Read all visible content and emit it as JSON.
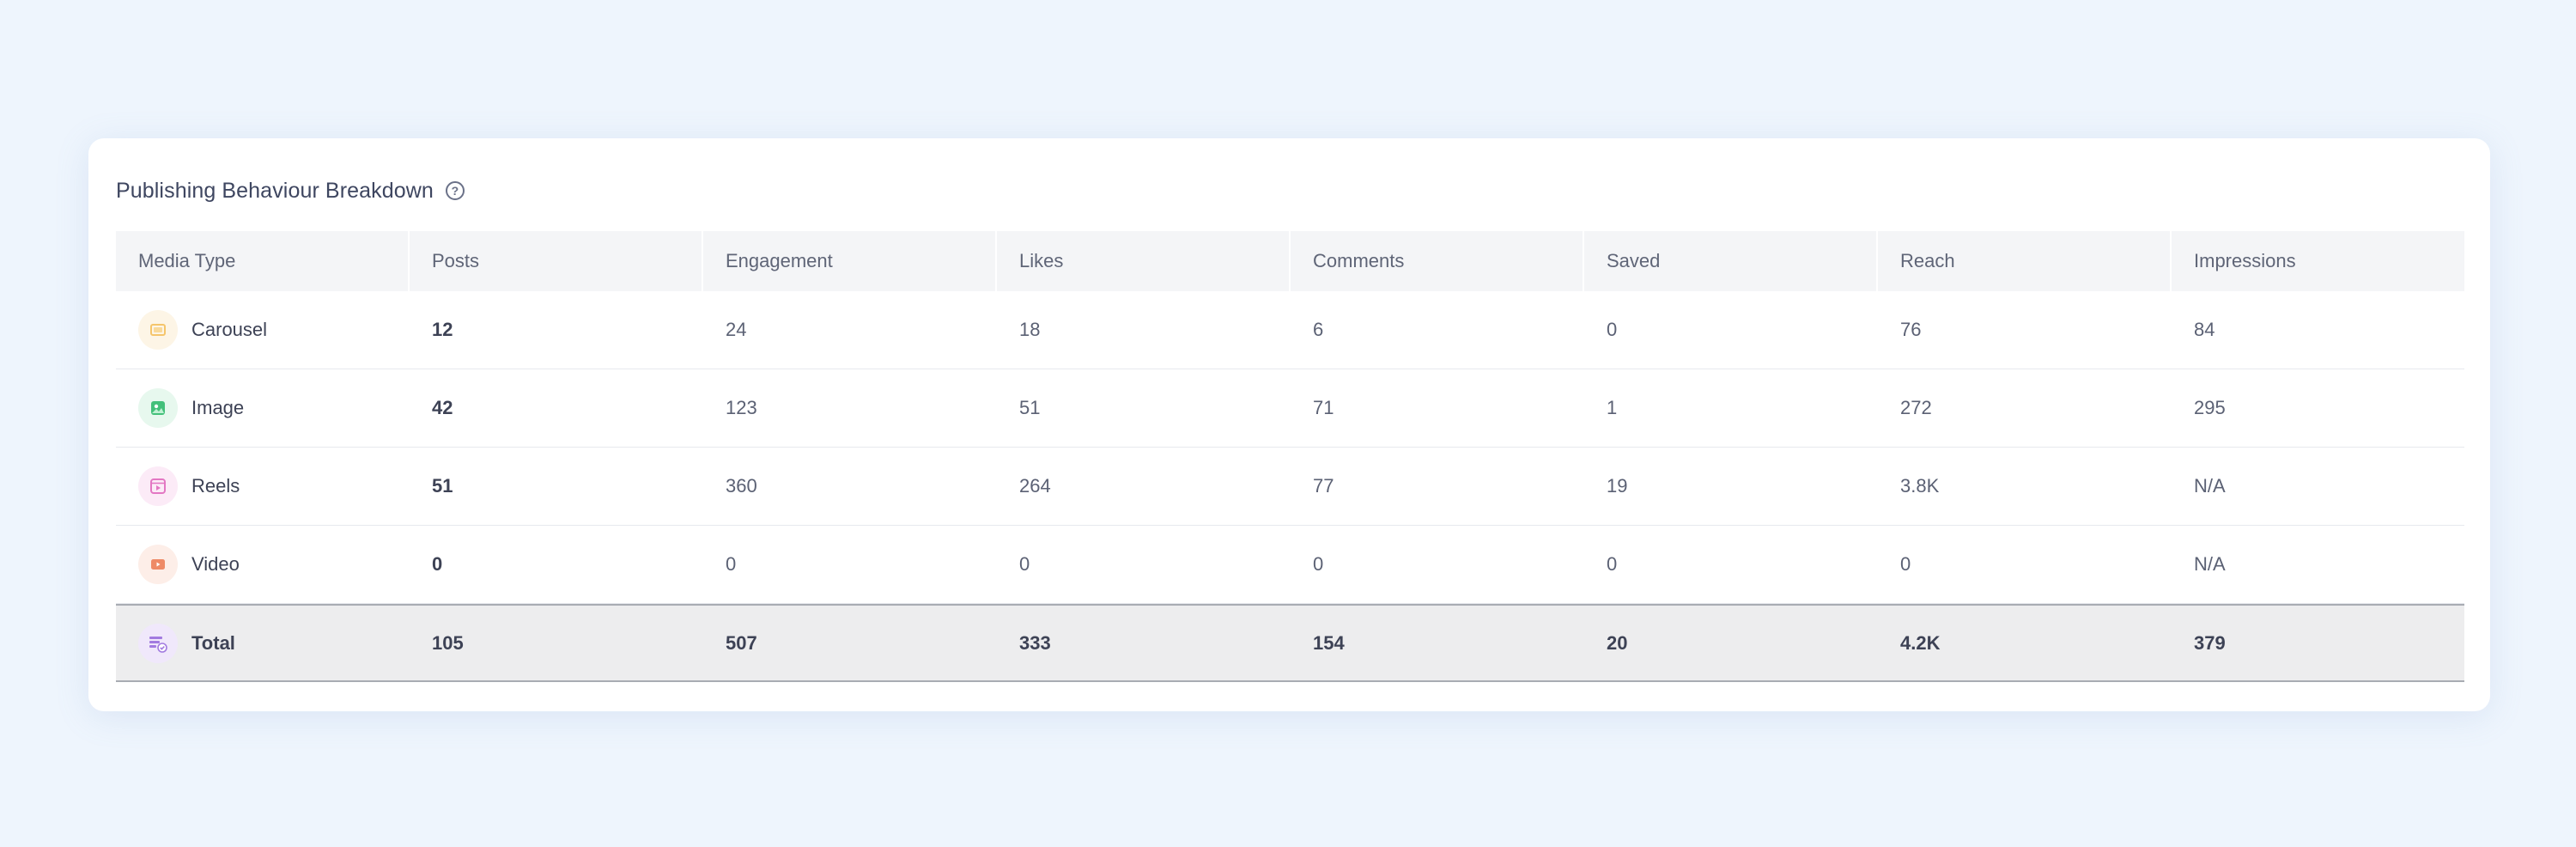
{
  "card": {
    "title": "Publishing Behaviour Breakdown"
  },
  "table": {
    "columns": [
      "Media Type",
      "Posts",
      "Engagement",
      "Likes",
      "Comments",
      "Saved",
      "Reach",
      "Impressions"
    ],
    "rows": [
      {
        "media": "Carousel",
        "icon": "carousel-icon",
        "posts": "12",
        "engagement": "24",
        "likes": "18",
        "comments": "6",
        "saved": "0",
        "reach": "76",
        "impressions": "84"
      },
      {
        "media": "Image",
        "icon": "image-icon",
        "posts": "42",
        "engagement": "123",
        "likes": "51",
        "comments": "71",
        "saved": "1",
        "reach": "272",
        "impressions": "295"
      },
      {
        "media": "Reels",
        "icon": "reels-icon",
        "posts": "51",
        "engagement": "360",
        "likes": "264",
        "comments": "77",
        "saved": "19",
        "reach": "3.8K",
        "impressions": "N/A"
      },
      {
        "media": "Video",
        "icon": "video-icon",
        "posts": "0",
        "engagement": "0",
        "likes": "0",
        "comments": "0",
        "saved": "0",
        "reach": "0",
        "impressions": "N/A"
      }
    ],
    "total": {
      "media": "Total",
      "icon": "total-icon",
      "posts": "105",
      "engagement": "507",
      "likes": "333",
      "comments": "154",
      "saved": "20",
      "reach": "4.2K",
      "impressions": "379"
    }
  },
  "colors": {
    "page_background": "#eef5fd",
    "carousel_icon": "#f5c56b",
    "image_icon": "#43c07a",
    "reels_icon": "#e377c3",
    "video_icon": "#ee8a66",
    "total_icon": "#a27be0"
  }
}
